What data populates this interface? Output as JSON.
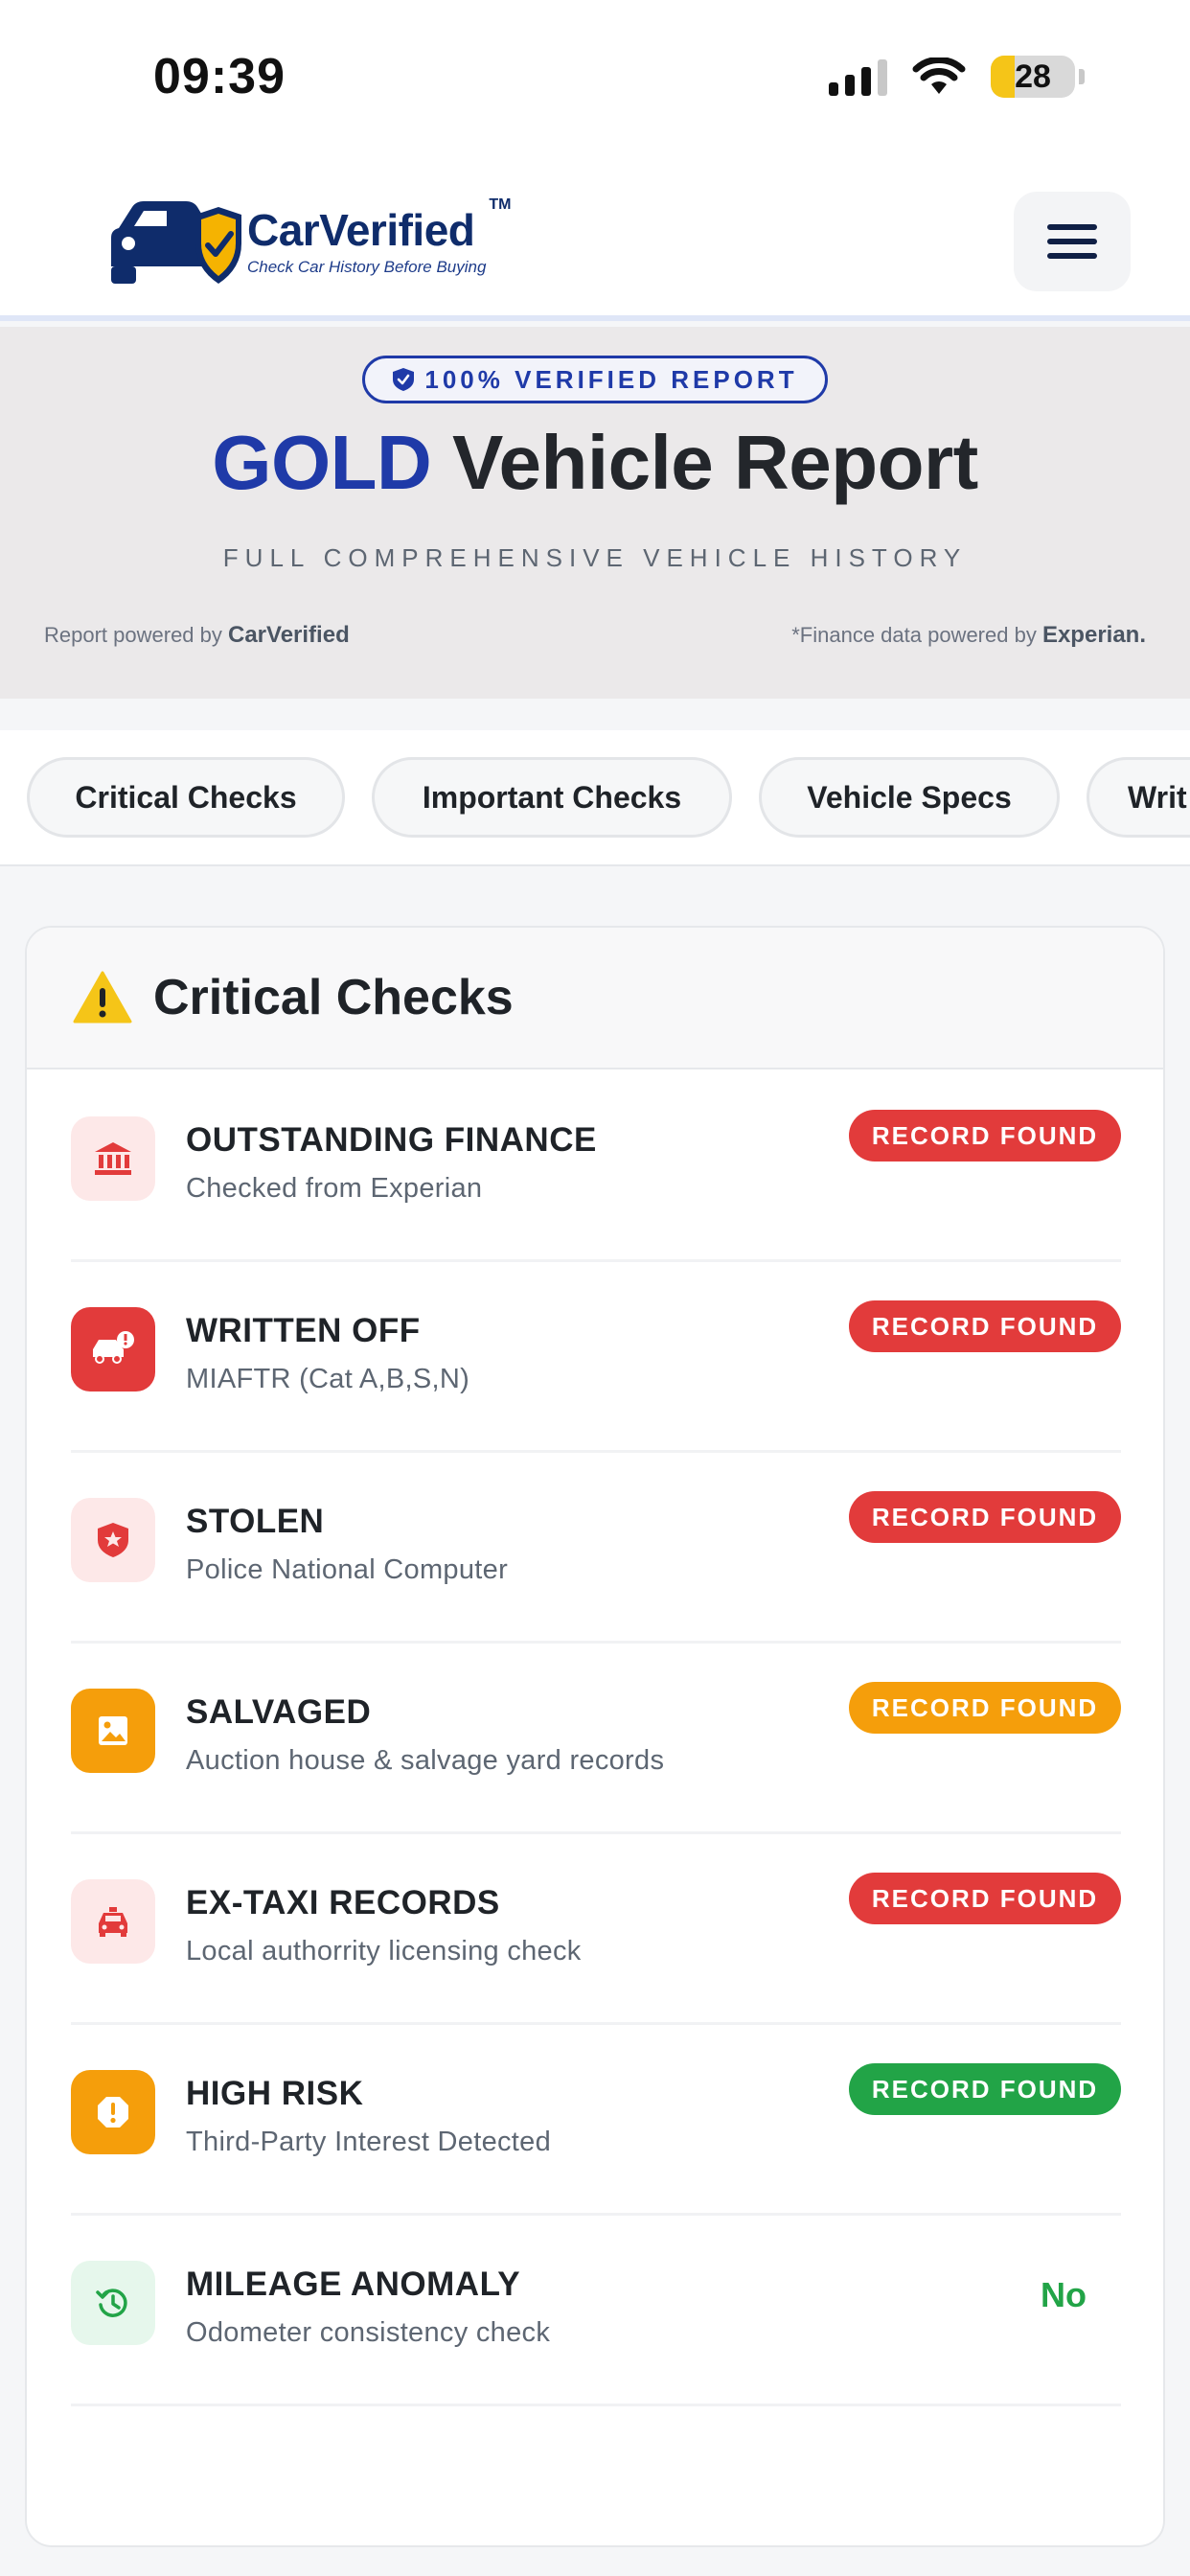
{
  "status_bar": {
    "time": "09:39",
    "battery": "28"
  },
  "header": {
    "logo_name": "CarVerified",
    "logo_tm": "TM",
    "logo_tagline": "Check Car History Before Buying"
  },
  "hero": {
    "badge": "100% VERIFIED REPORT",
    "title_highlight": "GOLD",
    "title_rest": " Vehicle Report",
    "subtitle": "FULL COMPREHENSIVE VEHICLE HISTORY",
    "powered_left_prefix": "Report powered by ",
    "powered_left_brand": "CarVerified",
    "powered_right_prefix": "*Finance data powered by ",
    "powered_right_brand": "Experian."
  },
  "tabs": [
    {
      "label": "Critical Checks"
    },
    {
      "label": "Important Checks"
    },
    {
      "label": "Vehicle Specs"
    },
    {
      "label": "Writ"
    }
  ],
  "critical": {
    "title": "Critical Checks",
    "rows": [
      {
        "title": "OUTSTANDING FINANCE",
        "subtitle": "Checked from Experian",
        "status": "RECORD FOUND",
        "status_color": "#e23b3b",
        "icon": "bank-icon",
        "icon_bg": "#fde8e8",
        "icon_fg": "#e23b3b"
      },
      {
        "title": "WRITTEN OFF",
        "subtitle": "MIAFTR (Cat A,B,S,N)",
        "status": "RECORD FOUND",
        "status_color": "#e23b3b",
        "icon": "car-crash-icon",
        "icon_bg": "#e23b3b",
        "icon_fg": "#ffffff"
      },
      {
        "title": "STOLEN",
        "subtitle": "Police National Computer",
        "status": "RECORD FOUND",
        "status_color": "#e23b3b",
        "icon": "police-shield-icon",
        "icon_bg": "#fde8e8",
        "icon_fg": "#e23b3b"
      },
      {
        "title": "SALVAGED",
        "subtitle": "Auction house & salvage yard records",
        "status": "RECORD FOUND",
        "status_color": "#f59e0b",
        "icon": "image-icon",
        "icon_bg": "#f59e0b",
        "icon_fg": "#ffffff"
      },
      {
        "title": "EX-TAXI RECORDS",
        "subtitle": "Local authorrity licensing check",
        "status": "RECORD FOUND",
        "status_color": "#e23b3b",
        "icon": "taxi-icon",
        "icon_bg": "#fde8e8",
        "icon_fg": "#e23b3b"
      },
      {
        "title": "HIGH RISK",
        "subtitle": "Third-Party Interest Detected",
        "status": "RECORD FOUND",
        "status_color": "#22a447",
        "icon": "alert-octagon-icon",
        "icon_bg": "#f59e0b",
        "icon_fg": "#ffffff"
      },
      {
        "title": "MILEAGE ANOMALY",
        "subtitle": "Odometer consistency check",
        "status": "No",
        "status_color": "#22a447",
        "icon": "history-icon",
        "icon_bg": "#e6f7ec",
        "icon_fg": "#22a447"
      }
    ]
  }
}
